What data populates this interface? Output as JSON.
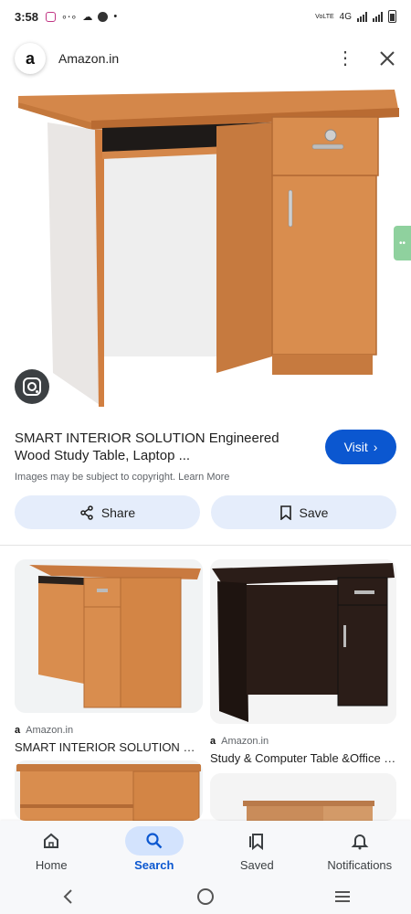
{
  "status_bar": {
    "time": "3:58",
    "network": "4G",
    "volte": "VoLTE"
  },
  "source": {
    "logo_letter": "a",
    "name": "Amazon.in"
  },
  "result": {
    "title": "SMART INTERIOR SOLUTION Engineered Wood Study Table, Laptop ...",
    "copyright": "Images may be subject to copyright. Learn More",
    "visit_label": "Visit"
  },
  "actions": {
    "share_label": "Share",
    "save_label": "Save"
  },
  "related": [
    {
      "source": "Amazon.in",
      "title": "SMART INTERIOR SOLUTION Engi..."
    },
    {
      "source": "Amazon.in",
      "title": "Study & Computer Table &Office D..."
    }
  ],
  "bottom_nav": [
    {
      "label": "Home",
      "icon": "home-icon"
    },
    {
      "label": "Search",
      "icon": "search-icon",
      "active": true
    },
    {
      "label": "Saved",
      "icon": "bookmarks-icon"
    },
    {
      "label": "Notifications",
      "icon": "bell-icon"
    }
  ],
  "colors": {
    "accent": "#0b57d0",
    "pill_bg": "#e5edfb",
    "wood": "#d98d4e",
    "dark_wood": "#2b1d18"
  }
}
